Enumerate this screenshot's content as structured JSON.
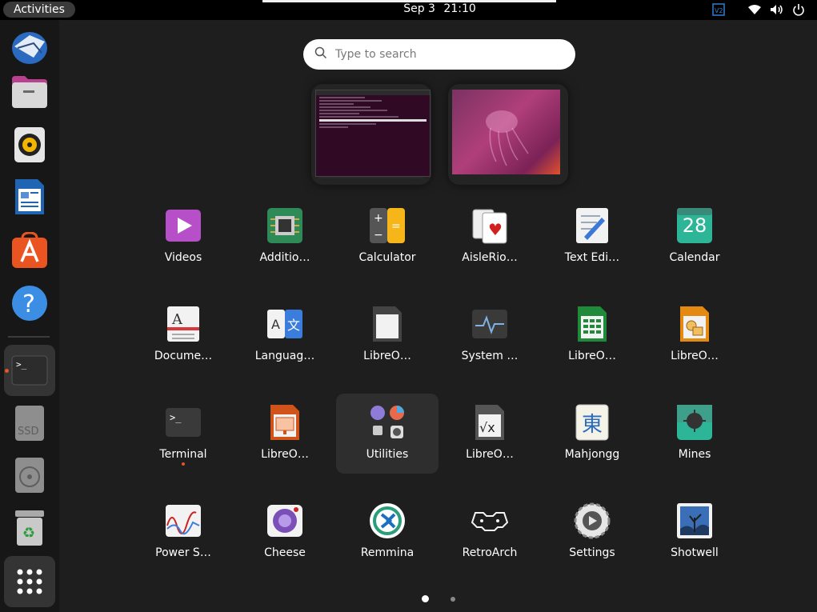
{
  "topbar": {
    "activities": "Activities",
    "date": "Sep 3",
    "time": "21:10"
  },
  "search": {
    "placeholder": "Type to search"
  },
  "apps": [
    {
      "label": "Videos",
      "icon": "videos-icon"
    },
    {
      "label": "Additio…",
      "icon": "additional-drivers-icon"
    },
    {
      "label": "Calculator",
      "icon": "calculator-icon"
    },
    {
      "label": "AisleRio…",
      "icon": "aisleriot-icon"
    },
    {
      "label": "Text Edi…",
      "icon": "text-editor-icon"
    },
    {
      "label": "Calendar",
      "icon": "calendar-icon",
      "text": "28"
    },
    {
      "label": "Docume…",
      "icon": "document-viewer-icon"
    },
    {
      "label": "Languag…",
      "icon": "language-support-icon"
    },
    {
      "label": "LibreO…",
      "icon": "libreoffice-icon"
    },
    {
      "label": "System …",
      "icon": "system-monitor-icon"
    },
    {
      "label": "LibreO…",
      "icon": "libreoffice-calc-icon"
    },
    {
      "label": "LibreO…",
      "icon": "libreoffice-draw-icon"
    },
    {
      "label": "Terminal",
      "icon": "terminal-icon"
    },
    {
      "label": "LibreO…",
      "icon": "libreoffice-impress-icon"
    },
    {
      "label": "Utilities",
      "icon": "utilities-folder-icon"
    },
    {
      "label": "LibreO…",
      "icon": "libreoffice-math-icon"
    },
    {
      "label": "Mahjongg",
      "icon": "mahjongg-icon",
      "text": "東"
    },
    {
      "label": "Mines",
      "icon": "mines-icon"
    },
    {
      "label": "Power S…",
      "icon": "power-statistics-icon"
    },
    {
      "label": "Cheese",
      "icon": "cheese-icon"
    },
    {
      "label": "Remmina",
      "icon": "remmina-icon"
    },
    {
      "label": "RetroArch",
      "icon": "retroarch-icon"
    },
    {
      "label": "Settings",
      "icon": "settings-icon"
    },
    {
      "label": "Shotwell",
      "icon": "shotwell-icon"
    }
  ],
  "dock": [
    "thunderbird-icon",
    "files-icon",
    "rhythmbox-icon",
    "libreoffice-writer-icon",
    "app-center-icon",
    "help-icon",
    "terminal-icon",
    "ssd-drive-icon",
    "disc-drive-icon",
    "trash-icon",
    "show-apps-icon"
  ],
  "dock_ssd_text": "SSD",
  "colors": {
    "accent": "#e95420",
    "panel": "#000000",
    "dock": "#171717",
    "background": "#1e1e1e"
  }
}
